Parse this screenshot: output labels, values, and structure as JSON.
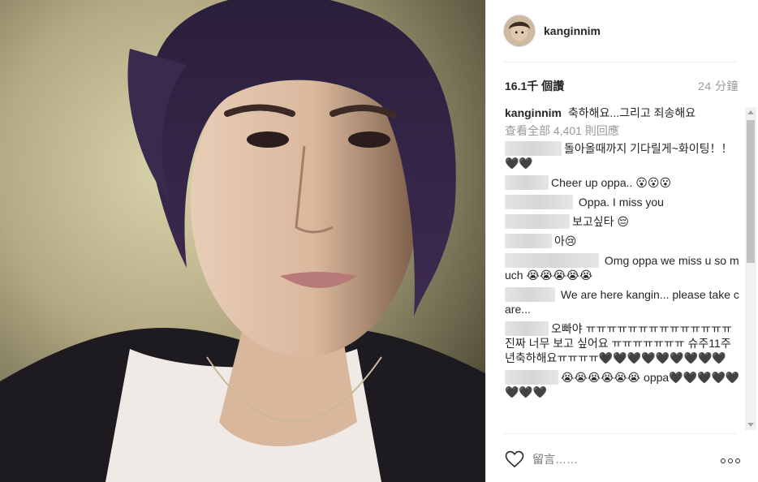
{
  "post": {
    "username": "kanginnim",
    "likes": "16.1千 個讚",
    "time": "24 分鐘",
    "caption": {
      "author": "kanginnim",
      "text": "축하해요...그리고 죄송해요"
    },
    "view_all": "查看全部 4,401 則回應",
    "comments": [
      {
        "text": "돌아올때까지 기다릴게~화이팅！！🖤🖤"
      },
      {
        "text": "Cheer up oppa.. 😮😮😮"
      },
      {
        "text": " Oppa. I miss you"
      },
      {
        "text": "보고싶타 😔"
      },
      {
        "text": "아😢"
      },
      {
        "text": " Omg oppa we miss u so much 😭😭😭😭😭"
      },
      {
        "text": " We are here kangin... please take care..."
      },
      {
        "text": "오빠야 ㅠㅠㅠㅠㅠㅠㅠㅠㅠㅠㅠㅠㅠㅠ 진짜 너무 보고 싶어요 ㅠㅠㅠㅠㅠㅠㅠ 슈주11주년축하해요ㅠㅠㅠㅠ🖤🖤🖤🖤🖤🖤🖤🖤🖤"
      },
      {
        "text": "😭😭😭😭😭😭 oppa🖤🖤🖤🖤🖤🖤🖤🖤"
      }
    ],
    "comment_placeholder": "留言……"
  },
  "icons": {
    "like": "heart-outline-icon",
    "more": "more-options-icon"
  },
  "colors": {
    "muted_text": "#999999",
    "primary_text": "#262626",
    "divider": "#efefef"
  }
}
